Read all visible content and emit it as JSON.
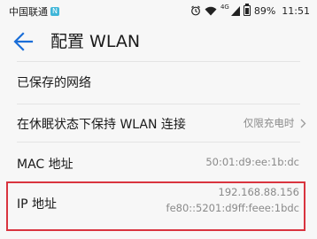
{
  "status_bar": {
    "carrier": "中国联通",
    "carrier_badge": "N",
    "net_type": "4G",
    "battery": "89%",
    "battery_level": 0.89,
    "time": "11:51"
  },
  "header": {
    "title": "配置 WLAN"
  },
  "settings": {
    "saved_networks": {
      "label": "已保存的网络"
    },
    "keep_wlan_on_sleep": {
      "label": "在休眠状态下保持 WLAN 连接",
      "value": "仅限充电时"
    },
    "mac_address": {
      "label": "MAC 地址",
      "value": "50:01:d9:ee:1b:dc"
    },
    "ip_address": {
      "label": "IP 地址",
      "ipv4": "192.168.88.156",
      "ipv6": "fe80::5201:d9ff:feee:1bdc"
    }
  },
  "colors": {
    "highlight_border": "#d9343f",
    "accent": "#1a6ed8"
  },
  "icons": {
    "back": "back-arrow-icon",
    "chevron": "chevron-right-icon"
  }
}
